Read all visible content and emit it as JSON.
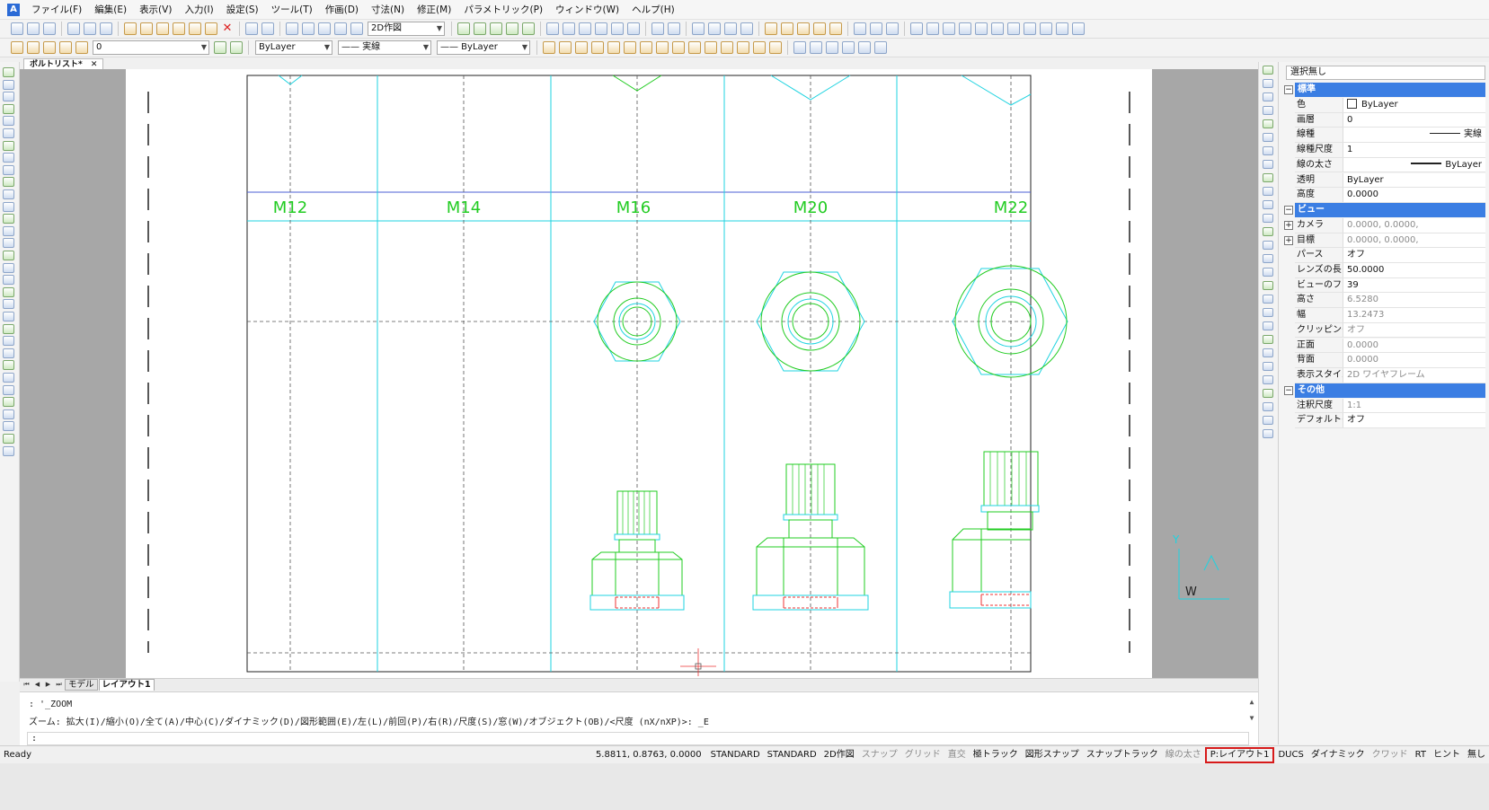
{
  "menu": [
    "ファイル(F)",
    "編集(E)",
    "表示(V)",
    "入力(I)",
    "設定(S)",
    "ツール(T)",
    "作画(D)",
    "寸法(N)",
    "修正(M)",
    "パラメトリック(P)",
    "ウィンドウ(W)",
    "ヘルプ(H)"
  ],
  "toolbar": {
    "workspace": "2D作図",
    "layer": "0",
    "color": "ByLayer",
    "linetype": "—— 実線",
    "lineweight": "—— ByLayer"
  },
  "doc_tab": {
    "label": "ボルトリスト*",
    "close": "✕"
  },
  "drawing": {
    "columns": [
      "M12",
      "M14",
      "M16",
      "M20",
      "M22"
    ],
    "ucs_y": "Y",
    "ucs_w": "W"
  },
  "properties": {
    "selection": "選択無し",
    "sections": [
      {
        "title": "標準",
        "rows": [
          {
            "name": "色",
            "value": "ByLayer"
          },
          {
            "name": "画層",
            "value": "0"
          },
          {
            "name": "線種",
            "value": "実線"
          },
          {
            "name": "線種尺度",
            "value": "1"
          },
          {
            "name": "線の太さ",
            "value": "ByLayer"
          },
          {
            "name": "透明",
            "value": "ByLayer"
          },
          {
            "name": "高度",
            "value": "0.0000"
          }
        ]
      },
      {
        "title": "ビュー",
        "rows": [
          {
            "name": "カメラ",
            "value": "0.0000, 0.0000,"
          },
          {
            "name": "目標",
            "value": "0.0000, 0.0000,"
          },
          {
            "name": "パース",
            "value": "オフ"
          },
          {
            "name": "レンズの長さ",
            "value": "50.0000"
          },
          {
            "name": "ビューのフィー",
            "value": "39"
          },
          {
            "name": "高さ",
            "value": "6.5280"
          },
          {
            "name": "幅",
            "value": "13.2473"
          },
          {
            "name": "クリッピング",
            "value": "オフ"
          },
          {
            "name": "正面",
            "value": "0.0000"
          },
          {
            "name": "背面",
            "value": "0.0000"
          },
          {
            "name": "表示スタイル",
            "value": "2D ワイヤフレーム"
          }
        ]
      },
      {
        "title": "その他",
        "rows": [
          {
            "name": "注釈尺度",
            "value": "1:1"
          },
          {
            "name": "デフォルトの則",
            "value": "オフ"
          }
        ]
      }
    ]
  },
  "layout_tabs": [
    "モデル",
    "レイアウト1"
  ],
  "command": {
    "line1": ": '_ZOOM",
    "line2": "ズーム:  拡大(I)/縮小(O)/全て(A)/中心(C)/ダイナミック(D)/図形範囲(E)/左(L)/前回(P)/右(R)/尺度(S)/窓(W)/オブジェクト(OB)/<尺度 (nX/nXP)>: _E",
    "prompt": ":"
  },
  "status": {
    "ready": "Ready",
    "coords": "5.8811, 0.8763, 0.0000",
    "buttons": [
      {
        "label": "STANDARD",
        "on": true
      },
      {
        "label": "STANDARD",
        "on": true
      },
      {
        "label": "2D作図",
        "on": true
      },
      {
        "label": "スナップ",
        "on": false
      },
      {
        "label": "グリッド",
        "on": false
      },
      {
        "label": "直交",
        "on": false
      },
      {
        "label": "極トラック",
        "on": true
      },
      {
        "label": "図形スナップ",
        "on": true
      },
      {
        "label": "スナップトラック",
        "on": true
      },
      {
        "label": "線の太さ",
        "on": false
      },
      {
        "label": "P:レイアウト1",
        "on": true,
        "highlight": true
      },
      {
        "label": "DUCS",
        "on": true
      },
      {
        "label": "ダイナミック",
        "on": true
      },
      {
        "label": "クワッド",
        "on": false
      },
      {
        "label": "RT",
        "on": true
      },
      {
        "label": "ヒント",
        "on": true
      },
      {
        "label": "無し",
        "on": true
      }
    ]
  },
  "colors": {
    "accent": "#3b7ee3",
    "cyan": "#1fd3e0",
    "green": "#22cc22",
    "highlight": "#d71a1a"
  }
}
